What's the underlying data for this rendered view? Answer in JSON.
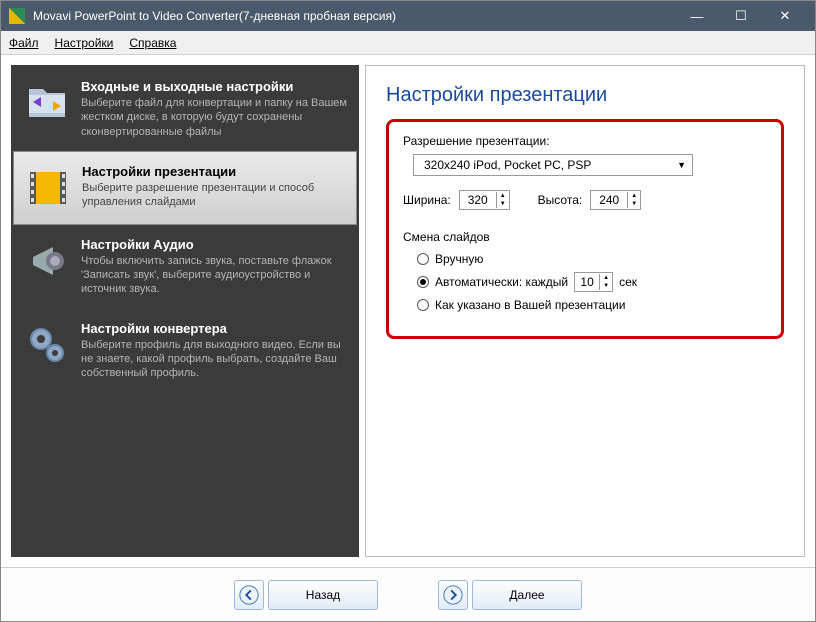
{
  "window": {
    "title": "Movavi PowerPoint to Video Converter(7-дневная пробная версия)"
  },
  "menu": {
    "file": "Файл",
    "settings": "Настройки",
    "help": "Справка"
  },
  "sidebar": {
    "items": [
      {
        "title": "Входные и выходные настройки",
        "desc": "Выберите файл для конвертации и папку на Вашем жестком диске, в которую будут сохранены сконвертированные файлы"
      },
      {
        "title": "Настройки презентации",
        "desc": "Выберите разрешение презентации и способ управления слайдами"
      },
      {
        "title": "Настройки Аудио",
        "desc": "Чтобы включить запись звука, поставьте флажок 'Записать звук', выберите аудиоустройство и источник звука."
      },
      {
        "title": "Настройки конвертера",
        "desc": "Выберите профиль для выходного видео. Если вы не знаете, какой профиль выбрать, создайте Ваш собственный профиль."
      }
    ]
  },
  "panel": {
    "title": "Настройки презентации",
    "resolution_label": "Разрешение презентации:",
    "resolution_value": "320x240 iPod, Pocket PC, PSP",
    "width_label": "Ширина:",
    "width_value": "320",
    "height_label": "Высота:",
    "height_value": "240",
    "slides_label": "Смена слайдов",
    "radio_manual": "Вручную",
    "radio_auto_prefix": "Автоматически: каждый",
    "radio_auto_value": "10",
    "radio_auto_suffix": "сек",
    "radio_asis": "Как указано в Вашей презентации"
  },
  "footer": {
    "back": "Назад",
    "next": "Далее"
  }
}
